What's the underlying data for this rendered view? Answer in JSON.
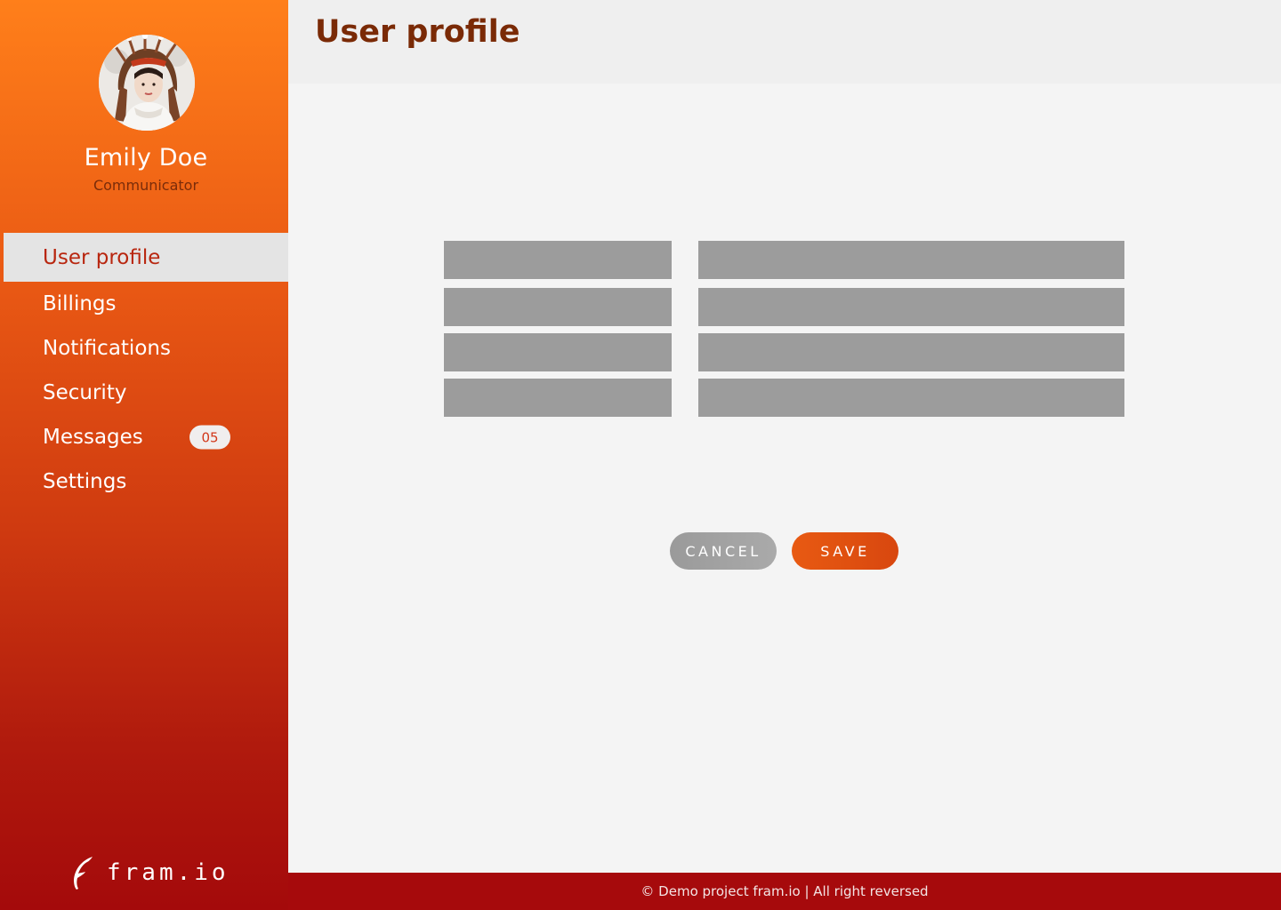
{
  "user": {
    "name": "Emily Doe",
    "role": "Communicator",
    "avatar_icon": "user-avatar-photo"
  },
  "sidebar": {
    "items": [
      {
        "label": "User profile",
        "active": true
      },
      {
        "label": "Billings",
        "active": false
      },
      {
        "label": "Notifications",
        "active": false
      },
      {
        "label": "Security",
        "active": false
      },
      {
        "label": "Messages",
        "active": false,
        "badge": "05"
      },
      {
        "label": "Settings",
        "active": false
      }
    ]
  },
  "logo": {
    "text": "fram.io",
    "icon": "feather-logo-icon"
  },
  "header": {
    "title": "User profile"
  },
  "form": {
    "rows": [
      {
        "label": "",
        "value": ""
      },
      {
        "label": "",
        "value": ""
      },
      {
        "label": "",
        "value": ""
      },
      {
        "label": "",
        "value": ""
      }
    ]
  },
  "actions": {
    "cancel_label": "CANCEL",
    "save_label": "SAVE"
  },
  "footer": {
    "text": "© Demo project fram.io | All right reversed"
  },
  "colors": {
    "sidebar_top": "#ff7f1a",
    "sidebar_bottom": "#a40a0b",
    "title": "#7a2a06",
    "active_item_text": "#b8260f",
    "field_bg": "#9c9c9c",
    "save_button": "#e2510f",
    "cancel_button": "#a0a0a0",
    "footer_bg": "#a60a0c"
  }
}
